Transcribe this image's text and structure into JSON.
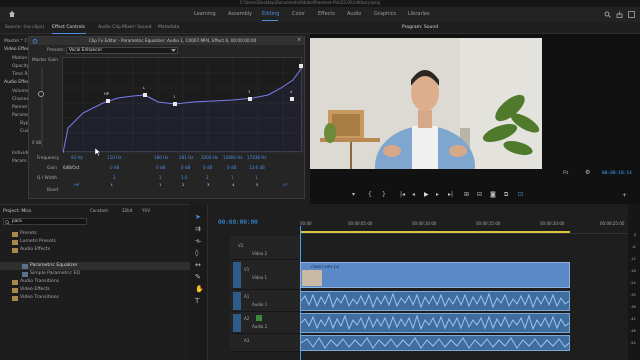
{
  "titlebar": {
    "path": "C:\\Users\\Desktop\\Documents\\Adobe\\Premiere Pro\\23.0\\Untitled.prproj"
  },
  "workspaces": [
    "Learning",
    "Assembly",
    "Editing",
    "Color",
    "Effects",
    "Audio",
    "Graphics",
    "Libraries"
  ],
  "active_workspace": "Editing",
  "left_tabs": [
    "Source: (no clips)",
    "Effect Controls",
    "Audio Clip Mixer: Sound",
    "Metadata"
  ],
  "program_tab": "Program: Sound",
  "effect_controls": {
    "header": "Master * C0007...",
    "video_effects": "Video Effects",
    "rows_video": [
      "Motion",
      "Opacity",
      "Time R..."
    ],
    "audio_effects": "Audio Effects",
    "rows_audio": [
      "Volume",
      "Channe...",
      "Panner",
      "Paramet..."
    ],
    "rows_sub": [
      "Bypas..",
      "Custo..."
    ],
    "rows_bottom": [
      "Individu...",
      "Param..."
    ]
  },
  "fx_editor": {
    "title": "Clip Fx Editor - Parametric Equalizer: Audio 1, C0007.MP4, Effect 6, 00:00:00:00",
    "presets_label": "Presets:",
    "preset_value": "Vocal Enhancer",
    "master_gain_label": "Master Gain",
    "graph_tick_left": "0 dB",
    "graph_bottom_labels": [
      "Hz",
      "20",
      "50",
      "100",
      "200",
      "500",
      "1k",
      "2k",
      "5k",
      "10k",
      "20k"
    ],
    "node_labels": [
      "L",
      "HP",
      "1",
      "2",
      "3",
      "4",
      "5",
      "H"
    ],
    "frequency_label": "Frequency",
    "frequencies": [
      "83 Hz",
      "110 Hz",
      "180 Hz",
      "281 Hz",
      "3200 Hz",
      "12800 Hz",
      "17438 Hz"
    ],
    "gain_label": "Gain",
    "gains": [
      "6dB/Oct",
      "0 dB",
      "0 dB",
      "0 dB",
      "0 dB",
      "0 dB",
      "13.6 dB"
    ],
    "q_label": "Q / Width",
    "q_values": [
      "1",
      "2",
      "1",
      "1.5",
      "2",
      "1",
      "1"
    ],
    "band_label": "Band",
    "bands": [
      "HP",
      "L",
      "1",
      "2",
      "3",
      "4",
      "5",
      "H",
      "LP"
    ]
  },
  "program": {
    "fit": "Fit",
    "timecode": "00:00:10:14"
  },
  "project": {
    "tab": "Project: Mics",
    "search": "para",
    "items": [
      "Presets",
      "Lumetri Presets",
      "Audio Effects",
      "Parametric Equalizer",
      "Simple Parametric EQ",
      "Audio Transitions",
      "Video Effects",
      "Video Transitions"
    ],
    "selected": "Parametric Equalizer",
    "accel_label": "Constant",
    "accel2": "32bit",
    "accel3": "YUV"
  },
  "timeline": {
    "timecode": "00:00:00:00",
    "ruler": [
      "00:00",
      "00:00:05:00",
      "00:00:10:00",
      "00:00:15:00",
      "00:00:20:00",
      "00:00:25:00"
    ],
    "tracks": [
      "V2",
      "V1",
      "A1",
      "A2",
      "A3"
    ],
    "track_names": [
      "Video 2",
      "Video 1",
      "Audio 1",
      "Audio 2"
    ],
    "clip_label": "C0007.MP4 [V]",
    "meter_labels": [
      "0",
      "-6",
      "-12",
      "-18",
      "-24",
      "-30",
      "-36",
      "-42",
      "-48",
      "-54"
    ]
  },
  "colors": {
    "accent": "#4a90e2",
    "clip_video": "#5b88c7",
    "clip_audio": "#3f6e9e",
    "wave": "#9ac4ee",
    "selected_track": "#3b8a3b"
  }
}
